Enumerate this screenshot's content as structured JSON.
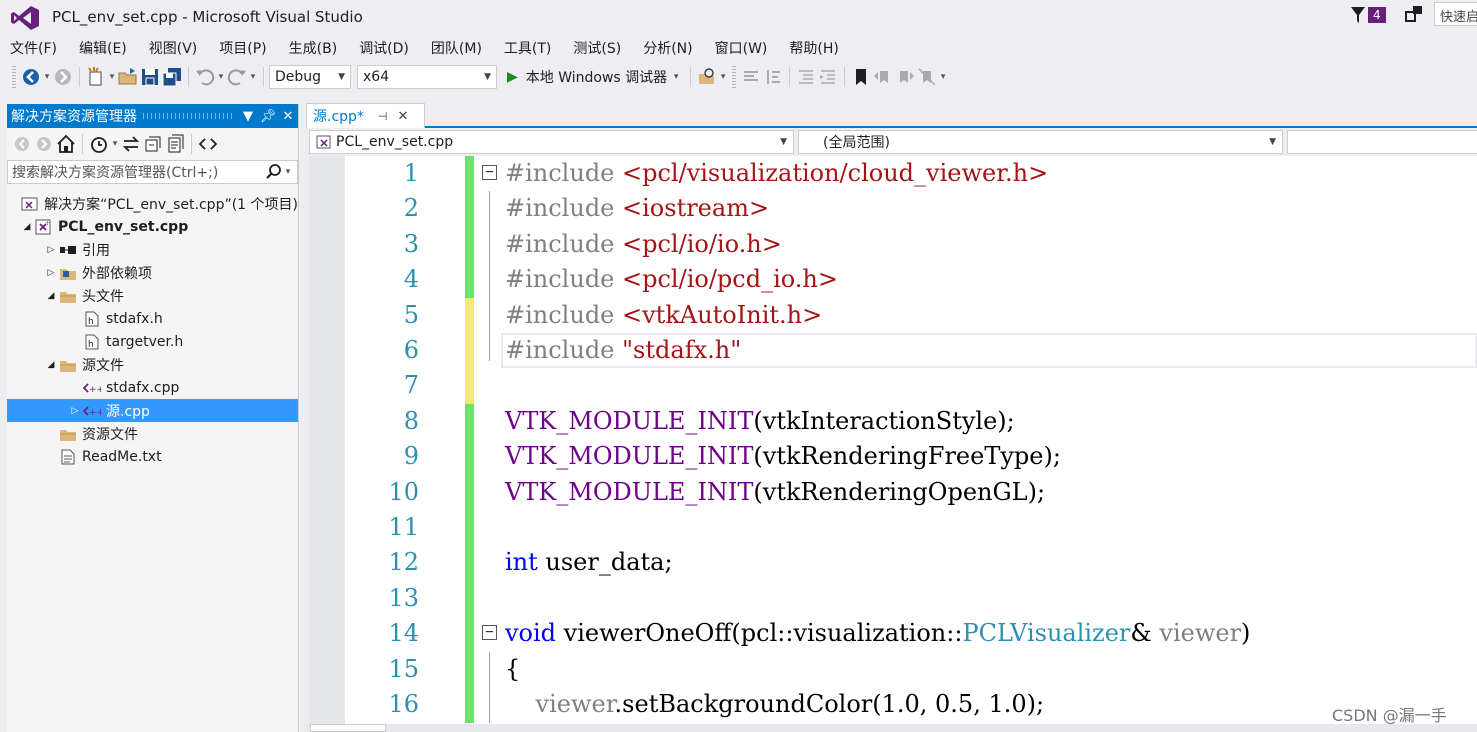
{
  "window": {
    "title": "PCL_env_set.cpp - Microsoft Visual Studio",
    "notification_count": "4",
    "quick_launch": "快速启动"
  },
  "menu": [
    "文件(F)",
    "编辑(E)",
    "视图(V)",
    "项目(P)",
    "生成(B)",
    "调试(D)",
    "团队(M)",
    "工具(T)",
    "测试(S)",
    "分析(N)",
    "窗口(W)",
    "帮助(H)"
  ],
  "toolbar": {
    "configuration": "Debug",
    "platform": "x64",
    "run_label": "本地 Windows 调试器"
  },
  "solution_explorer": {
    "title": "解决方案资源管理器",
    "search_placeholder": "搜索解决方案资源管理器(Ctrl+;)",
    "tree": [
      {
        "label": "解决方案“PCL_env_set.cpp”(1 个项目)",
        "icon": "solution-icon",
        "twisty": "",
        "bold": false
      },
      {
        "label": "PCL_env_set.cpp",
        "icon": "project-icon",
        "twisty": "◢",
        "bold": true
      },
      {
        "label": "引用",
        "icon": "references-icon",
        "twisty": "▷",
        "bold": false
      },
      {
        "label": "外部依赖项",
        "icon": "external-deps-icon",
        "twisty": "▷",
        "bold": false
      },
      {
        "label": "头文件",
        "icon": "folder-icon",
        "twisty": "◢",
        "bold": false
      },
      {
        "label": "stdafx.h",
        "icon": "header-file-icon",
        "twisty": "",
        "bold": false
      },
      {
        "label": "targetver.h",
        "icon": "header-file-icon",
        "twisty": "",
        "bold": false
      },
      {
        "label": "源文件",
        "icon": "folder-icon",
        "twisty": "◢",
        "bold": false
      },
      {
        "label": "stdafx.cpp",
        "icon": "cpp-file-icon",
        "twisty": "",
        "bold": false
      },
      {
        "label": "源.cpp",
        "icon": "cpp-file-icon",
        "twisty": "▷",
        "bold": false,
        "selected": true
      },
      {
        "label": "资源文件",
        "icon": "folder-icon",
        "twisty": "",
        "bold": false
      },
      {
        "label": "ReadMe.txt",
        "icon": "text-file-icon",
        "twisty": "",
        "bold": false
      }
    ]
  },
  "editor": {
    "tab_label": "源.cpp*",
    "nav_file": "PCL_env_set.cpp",
    "nav_scope": "(全局范围)",
    "lines": [
      {
        "n": "1",
        "bar": "green",
        "fold": "box",
        "tokens": [
          [
            "kw-pre",
            "#include "
          ],
          [
            "str",
            "<pcl/visualization/cloud_viewer.h>"
          ]
        ]
      },
      {
        "n": "2",
        "bar": "green",
        "fold": "line",
        "tokens": [
          [
            "kw-pre",
            "#include "
          ],
          [
            "str",
            "<iostream>"
          ]
        ]
      },
      {
        "n": "3",
        "bar": "green",
        "fold": "line",
        "tokens": [
          [
            "kw-pre",
            "#include "
          ],
          [
            "str",
            "<pcl/io/io.h>"
          ]
        ]
      },
      {
        "n": "4",
        "bar": "green",
        "fold": "line",
        "tokens": [
          [
            "kw-pre",
            "#include "
          ],
          [
            "str",
            "<pcl/io/pcd_io.h>"
          ]
        ]
      },
      {
        "n": "5",
        "bar": "yellow",
        "fold": "line",
        "tokens": [
          [
            "kw-pre",
            "#include "
          ],
          [
            "str",
            "<vtkAutoInit.h>"
          ]
        ]
      },
      {
        "n": "6",
        "bar": "yellow",
        "fold": "end",
        "current": true,
        "tokens": [
          [
            "kw-pre",
            "#include "
          ],
          [
            "str",
            "\"stdafx.h\""
          ]
        ]
      },
      {
        "n": "7",
        "bar": "yellow",
        "fold": "",
        "tokens": []
      },
      {
        "n": "8",
        "bar": "green",
        "fold": "",
        "tokens": [
          [
            "mac",
            "VTK_MODULE_INIT"
          ],
          [
            "plain",
            "(vtkInteractionStyle);"
          ]
        ]
      },
      {
        "n": "9",
        "bar": "green",
        "fold": "",
        "tokens": [
          [
            "mac",
            "VTK_MODULE_INIT"
          ],
          [
            "plain",
            "(vtkRenderingFreeType);"
          ]
        ]
      },
      {
        "n": "10",
        "bar": "green",
        "fold": "",
        "tokens": [
          [
            "mac",
            "VTK_MODULE_INIT"
          ],
          [
            "plain",
            "(vtkRenderingOpenGL);"
          ]
        ]
      },
      {
        "n": "11",
        "bar": "green",
        "fold": "",
        "tokens": []
      },
      {
        "n": "12",
        "bar": "green",
        "fold": "",
        "tokens": [
          [
            "kw",
            "int"
          ],
          [
            "plain",
            " user_data;"
          ]
        ]
      },
      {
        "n": "13",
        "bar": "green",
        "fold": "",
        "tokens": []
      },
      {
        "n": "14",
        "bar": "green",
        "fold": "box",
        "tokens": [
          [
            "kw",
            "void"
          ],
          [
            "plain",
            " viewerOneOff(pcl::visualization::"
          ],
          [
            "typ",
            "PCLVisualizer"
          ],
          [
            "plain",
            "& "
          ],
          [
            "param",
            "viewer"
          ],
          [
            "plain",
            ")"
          ]
        ]
      },
      {
        "n": "15",
        "bar": "green",
        "fold": "line",
        "tokens": [
          [
            "plain",
            "{"
          ]
        ]
      },
      {
        "n": "16",
        "bar": "green",
        "fold": "line",
        "tokens": [
          [
            "plain",
            "    "
          ],
          [
            "param",
            "viewer"
          ],
          [
            "plain",
            ".setBackgroundColor(1.0, 0.5, 1.0);"
          ]
        ]
      }
    ]
  },
  "watermark": "CSDN @漏一手",
  "colors": {
    "accent": "#007acc",
    "change_saved": "#6ce26c",
    "change_unsaved": "#f6e97a",
    "selection": "#3399ff"
  }
}
